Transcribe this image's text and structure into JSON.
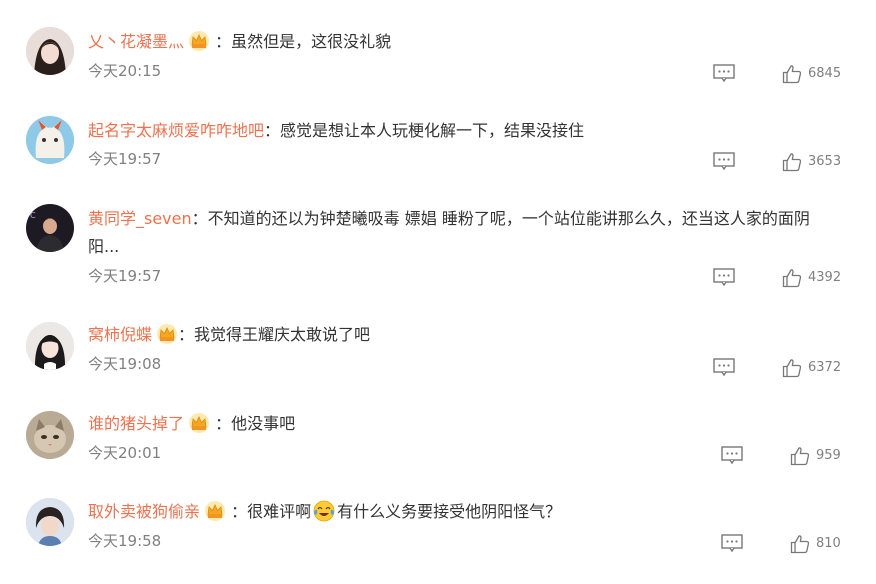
{
  "comments": [
    {
      "username": "乂丶花凝墨灬",
      "text": "：虽然但是，这很没礼貌",
      "time": "今天20:15",
      "likes": "6845",
      "badge": "crown-badge-icon"
    },
    {
      "username": "起名字太麻烦爱咋咋地吧",
      "text": "：感觉是想让本人玩梗化解一下，结果没接住",
      "time": "今天19:57",
      "likes": "3653"
    },
    {
      "username": "黄同学_seven",
      "text": "：不知道的还以为钟楚曦吸毒 嫖娼 睡粉了呢，一个站位能讲那么久，还当这人家的面阴",
      "text_line2": "阳...",
      "time": "今天19:57",
      "likes": "4392"
    },
    {
      "username": "窝柿倪蝶",
      "text": "：我觉得王耀庆太敢说了吧",
      "time": "今天19:08",
      "likes": "6372",
      "badge": "crown-badge-icon"
    },
    {
      "username": "谁的猪头掉了",
      "text": "：他没事吧",
      "time": "今天20:01",
      "likes": "959",
      "badge": "crown-badge-icon"
    },
    {
      "username": "取外卖被狗偷亲",
      "text": "：很难评啊",
      "text_after_emoji": "有什么义务要接受他阴阳怪气？",
      "emoji": "laughing-tears-emoji-icon",
      "time": "今天19:58",
      "likes": "810",
      "badge": "crown-badge-icon"
    }
  ],
  "icons": {
    "reply": "comment-reply-icon",
    "like": "thumbs-up-icon"
  },
  "colors": {
    "username": "#eb7350",
    "text": "#333333",
    "meta": "#808080"
  }
}
